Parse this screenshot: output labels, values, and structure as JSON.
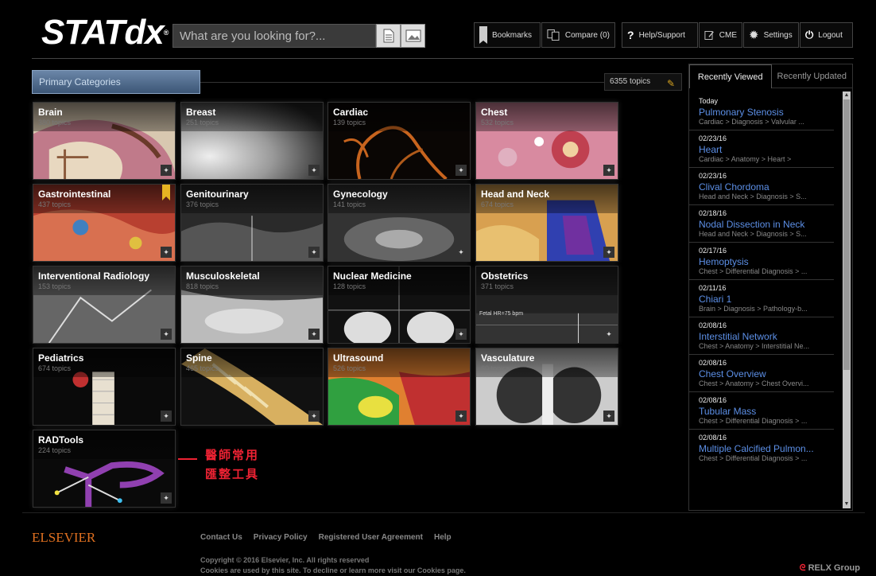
{
  "header": {
    "logo": "STATdx",
    "search_placeholder": "What are you looking for?...",
    "nav": {
      "bookmarks": "Bookmarks",
      "compare": "Compare (0)",
      "help": "Help/Support",
      "cme": "CME",
      "settings": "Settings",
      "logout": "Logout"
    }
  },
  "main": {
    "section_title": "Primary Categories",
    "topic_count": "6355 topics",
    "categories": [
      {
        "name": "Brain",
        "count": "380 topics"
      },
      {
        "name": "Breast",
        "count": "251 topics"
      },
      {
        "name": "Cardiac",
        "count": "139 topics"
      },
      {
        "name": "Chest",
        "count": "532 topics"
      },
      {
        "name": "Gastrointestinal",
        "count": "437 topics"
      },
      {
        "name": "Genitourinary",
        "count": "376 topics"
      },
      {
        "name": "Gynecology",
        "count": "141 topics"
      },
      {
        "name": "Head and Neck",
        "count": "674 topics"
      },
      {
        "name": "Interventional Radiology",
        "count": "153 topics"
      },
      {
        "name": "Musculoskeletal",
        "count": "818 topics"
      },
      {
        "name": "Nuclear Medicine",
        "count": "128 topics"
      },
      {
        "name": "Obstetrics",
        "count": "371 topics"
      },
      {
        "name": "Pediatrics",
        "count": "674 topics"
      },
      {
        "name": "Spine",
        "count": "465 topics"
      },
      {
        "name": "Ultrasound",
        "count": "526 topics"
      },
      {
        "name": "Vasculature",
        "count": "60 topics"
      },
      {
        "name": "RADTools",
        "count": "224 topics"
      }
    ],
    "fetal_hr_label": "Fetal HR=75 bpm",
    "annotation_line1": "醫師常用",
    "annotation_line2": "匯整工具"
  },
  "sidebar": {
    "tabs": [
      "Recently Viewed",
      "Recently Updated"
    ],
    "items": [
      {
        "date": "Today",
        "title": "Pulmonary Stenosis",
        "path": "Cardiac > Diagnosis > Valvular ..."
      },
      {
        "date": "02/23/16",
        "title": "Heart",
        "path": "Cardiac > Anatomy > Heart >"
      },
      {
        "date": "02/23/16",
        "title": "Clival Chordoma",
        "path": "Head and Neck > Diagnosis > S..."
      },
      {
        "date": "02/18/16",
        "title": "Nodal Dissection in Neck",
        "path": "Head and Neck > Diagnosis > S..."
      },
      {
        "date": "02/17/16",
        "title": "Hemoptysis",
        "path": "Chest > Differential Diagnosis > ..."
      },
      {
        "date": "02/11/16",
        "title": "Chiari 1",
        "path": "Brain > Diagnosis > Pathology-b..."
      },
      {
        "date": "02/08/16",
        "title": "Interstitial Network",
        "path": "Chest > Anatomy > Interstitial Ne..."
      },
      {
        "date": "02/08/16",
        "title": "Chest Overview",
        "path": "Chest > Anatomy > Chest Overvi..."
      },
      {
        "date": "02/08/16",
        "title": "Tubular Mass",
        "path": "Chest > Differential Diagnosis > ..."
      },
      {
        "date": "02/08/16",
        "title": "Multiple Calcified Pulmon...",
        "path": "Chest > Differential Diagnosis > ..."
      }
    ]
  },
  "footer": {
    "brand": "ELSEVIER",
    "links": [
      "Contact Us",
      "Privacy Policy",
      "Registered User Agreement",
      "Help"
    ],
    "copyright": "Copyright  © 2016 Elsevier, Inc. All rights reserved",
    "cookies": "Cookies are used by this site. To decline or learn more visit our Cookies page.",
    "relx": "RELX Group"
  }
}
